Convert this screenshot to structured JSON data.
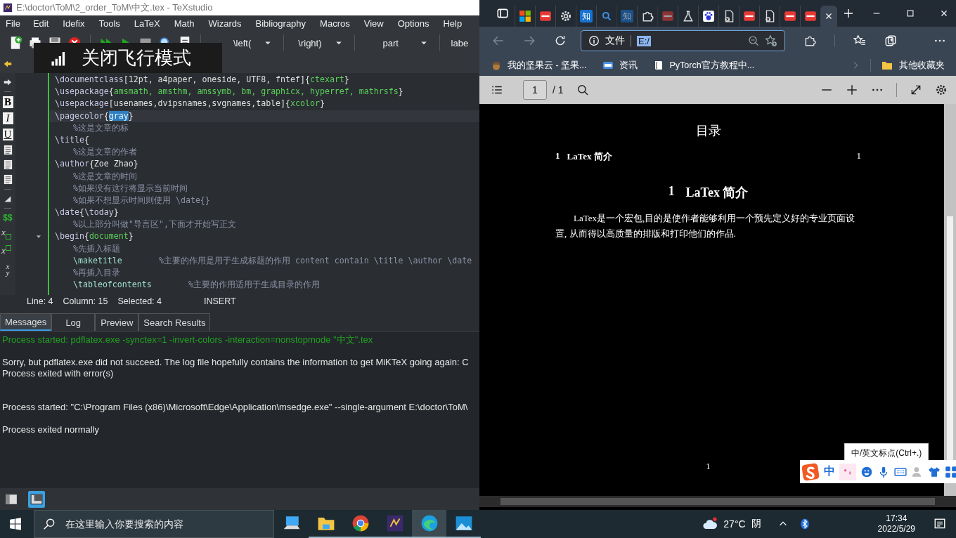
{
  "texstudio": {
    "title": "E:\\doctor\\ToM\\2_order_ToM\\中文.tex - TeXstudio",
    "menu": [
      "File",
      "Edit",
      "Idefix",
      "Tools",
      "LaTeX",
      "Math",
      "Wizards",
      "Bibliography",
      "Macros",
      "View",
      "Options",
      "Help"
    ],
    "dropdowns": [
      {
        "label": "\\left(",
        "caret": true
      },
      {
        "label": "\\right)",
        "caret": true
      },
      {
        "label": "part",
        "caret": true
      },
      {
        "label": "labe",
        "caret": false
      }
    ],
    "format_buttons": [
      {
        "label": "B",
        "kind": "bold"
      },
      {
        "label": "I",
        "kind": "italic"
      },
      {
        "label": "U",
        "kind": "underline"
      }
    ],
    "math_buttons": [
      {
        "kind": "dollar",
        "label": "$$"
      },
      {
        "kind": "subscript",
        "label": "x"
      },
      {
        "kind": "superscript",
        "label": "x"
      },
      {
        "kind": "fraction",
        "numerator": "x",
        "denominator": "y"
      }
    ],
    "lines": [
      {
        "indent": false,
        "current": false,
        "segments": [
          {
            "kind": "command",
            "text": "\\documentclass"
          },
          {
            "kind": "option",
            "text": "[12pt, a4paper, oneside, UTF8, fntef]"
          },
          {
            "kind": "brace",
            "text": "{"
          },
          {
            "kind": "argument",
            "text": "ctexart"
          },
          {
            "kind": "brace",
            "text": "}"
          }
        ]
      },
      {
        "indent": false,
        "current": false,
        "segments": [
          {
            "kind": "command",
            "text": "\\usepackage"
          },
          {
            "kind": "brace",
            "text": "{"
          },
          {
            "kind": "argument",
            "text": "amsmath, amsthm, amssymb, bm, graphicx, hyperref, mathrsfs"
          },
          {
            "kind": "brace",
            "text": "}"
          }
        ]
      },
      {
        "indent": false,
        "current": false,
        "segments": [
          {
            "kind": "command",
            "text": "\\usepackage"
          },
          {
            "kind": "option",
            "text": "[usenames,dvipsnames,svgnames,table]"
          },
          {
            "kind": "brace",
            "text": "{"
          },
          {
            "kind": "argument",
            "text": "xcolor"
          },
          {
            "kind": "brace",
            "text": "}"
          }
        ]
      },
      {
        "indent": false,
        "current": true,
        "segments": [
          {
            "kind": "command",
            "text": "\\pagecolor"
          },
          {
            "kind": "brace",
            "text": "{"
          },
          {
            "kind": "selection",
            "text": "gray"
          },
          {
            "kind": "brace",
            "text": "}"
          }
        ]
      },
      {
        "indent": true,
        "current": false,
        "segments": [
          {
            "kind": "comment",
            "text": "%这是文章的标"
          }
        ]
      },
      {
        "indent": false,
        "current": false,
        "segments": [
          {
            "kind": "command",
            "text": "\\title"
          },
          {
            "kind": "brace",
            "text": "{"
          }
        ]
      },
      {
        "indent": true,
        "current": false,
        "segments": [
          {
            "kind": "comment",
            "text": "%这是文章的作者"
          }
        ]
      },
      {
        "indent": false,
        "current": false,
        "segments": [
          {
            "kind": "command",
            "text": "\\author"
          },
          {
            "kind": "brace",
            "text": "{"
          },
          {
            "kind": "text",
            "text": "Zoe Zhao"
          },
          {
            "kind": "brace",
            "text": "}"
          }
        ]
      },
      {
        "indent": true,
        "current": false,
        "segments": [
          {
            "kind": "comment",
            "text": "%这是文章的时间"
          }
        ]
      },
      {
        "indent": true,
        "current": false,
        "segments": [
          {
            "kind": "comment",
            "text": "%如果没有这行将显示当前时间"
          }
        ]
      },
      {
        "indent": true,
        "current": false,
        "segments": [
          {
            "kind": "comment",
            "text": "%如果不想显示时间则使用 \\date{}"
          }
        ]
      },
      {
        "indent": false,
        "current": false,
        "segments": [
          {
            "kind": "command",
            "text": "\\date"
          },
          {
            "kind": "brace",
            "text": "{"
          },
          {
            "kind": "command",
            "text": "\\today"
          },
          {
            "kind": "brace",
            "text": "}"
          }
        ]
      },
      {
        "indent": true,
        "current": false,
        "segments": [
          {
            "kind": "comment",
            "text": "%以上部分叫做\"导言区\",下面才开始写正文"
          }
        ]
      },
      {
        "indent": false,
        "current": false,
        "expanded": true,
        "segments": [
          {
            "kind": "command",
            "text": "\\begin"
          },
          {
            "kind": "brace",
            "text": "{"
          },
          {
            "kind": "argument",
            "text": "document"
          },
          {
            "kind": "brace",
            "text": "}"
          }
        ]
      },
      {
        "indent": true,
        "current": false,
        "segments": [
          {
            "kind": "comment",
            "text": "%先插入标题"
          }
        ]
      },
      {
        "indent": true,
        "current": false,
        "segments": [
          {
            "kind": "keyword",
            "text": "\\maketitle"
          },
          {
            "kind": "comment",
            "text": "%主要的作用是用于生成标题的作用 content contain \\title \\author \\date"
          }
        ]
      },
      {
        "indent": true,
        "current": false,
        "segments": [
          {
            "kind": "comment",
            "text": "%再插入目录"
          }
        ]
      },
      {
        "indent": true,
        "current": false,
        "segments": [
          {
            "kind": "keyword",
            "text": "\\tableofcontents"
          },
          {
            "kind": "comment",
            "text": "%主要的作用适用于生成目录的作用"
          }
        ]
      }
    ],
    "status": {
      "line": "Line: 4",
      "column": "Column: 15",
      "selected": "Selected: 4",
      "mode": "INSERT"
    },
    "panel_tabs": [
      {
        "label": "Messages",
        "selected": true
      },
      {
        "label": "Log",
        "selected": false
      },
      {
        "label": "Preview",
        "selected": false
      },
      {
        "label": "Search Results",
        "selected": false
      }
    ],
    "messages": [
      {
        "kind": "started",
        "text": "Process started: pdflatex.exe -synctex=1 -invert-colors  -interaction=nonstopmode \"中文\".tex"
      },
      {
        "kind": "error",
        "text": "Sorry, but pdflatex.exe did not succeed. The log file hopefully contains the information to get MiKTeX going again: C"
      },
      {
        "kind": "plain",
        "text": "Process exited with error(s)"
      },
      {
        "kind": "plain",
        "text": "Process started: \"C:\\Program Files (x86)\\Microsoft\\Edge\\Application\\msedge.exe\" --single-argument E:\\doctor\\ToM\\"
      },
      {
        "kind": "plain",
        "text": "Process exited normally"
      }
    ],
    "dock": [
      {
        "selected": false
      },
      {
        "selected": true
      }
    ]
  },
  "toast": {
    "text": "关闭飞行模式"
  },
  "edge": {
    "tabs": [
      {
        "kind": "windows",
        "sleeping": false,
        "selected": false
      },
      {
        "kind": "pdf",
        "sleeping": false,
        "selected": false
      },
      {
        "kind": "gear",
        "sleeping": false,
        "selected": false
      },
      {
        "kind": "zhi",
        "label": "知",
        "sleeping": false,
        "selected": false
      },
      {
        "kind": "search",
        "sleeping": false,
        "selected": false
      },
      {
        "kind": "zhi",
        "label": "知",
        "sleeping": true,
        "selected": false
      },
      {
        "kind": "puzzle",
        "sleeping": false,
        "selected": false
      },
      {
        "kind": "pdf",
        "sleeping": true,
        "selected": false
      },
      {
        "kind": "flask",
        "sleeping": false,
        "selected": false
      },
      {
        "kind": "paw",
        "sleeping": false,
        "selected": false
      },
      {
        "kind": "file",
        "sleeping": false,
        "selected": false
      },
      {
        "kind": "pdf",
        "sleeping": false,
        "selected": false
      },
      {
        "kind": "file",
        "sleeping": false,
        "selected": false
      },
      {
        "kind": "pdf",
        "sleeping": false,
        "selected": false
      },
      {
        "kind": "pdf",
        "sleeping": false,
        "selected": false
      },
      {
        "kind": "blank",
        "sleeping": false,
        "selected": true
      }
    ],
    "site": "文件",
    "url": {
      "text": "E:/",
      "selected": true
    },
    "bookmarks": [
      {
        "kind": "acorn",
        "label": "我的坚果云 - 坚果..."
      },
      {
        "kind": "news",
        "label": "资讯"
      },
      {
        "kind": "book",
        "label": "PyTorch官方教程中..."
      }
    ],
    "folder": "其他收藏夹"
  },
  "pdf": {
    "page": "1",
    "total": "/ 1",
    "toc_title": "目录",
    "toc": [
      {
        "number": "1",
        "title": "LaTex 简介",
        "page": "1"
      }
    ],
    "section": {
      "number": "1",
      "title": "LaTex 简介"
    },
    "paragraph": "LaTex是一个宏包,目的是使作者能够利用一个预先定义好的专业页面设置, 从而得以高质量的排版和打印他们的作品.",
    "page_number": "1"
  },
  "ime": {
    "tooltip": "中/英文标点(Ctrl+.)",
    "mode": "中"
  },
  "taskbar": {
    "search_placeholder": "在这里输入你要搜索的内容",
    "apps": [
      {
        "kind": "computer",
        "running": false,
        "selected": false
      },
      {
        "kind": "folder",
        "running": true,
        "selected": false
      },
      {
        "kind": "chrome",
        "running": true,
        "selected": false
      },
      {
        "kind": "texstudio",
        "running": true,
        "selected": false
      },
      {
        "kind": "edge",
        "running": true,
        "selected": true
      },
      {
        "kind": "photos",
        "running": true,
        "selected": false
      }
    ],
    "temperature": "27°C",
    "weather": "阴",
    "time": "17:34",
    "date": "2022/5/29"
  }
}
